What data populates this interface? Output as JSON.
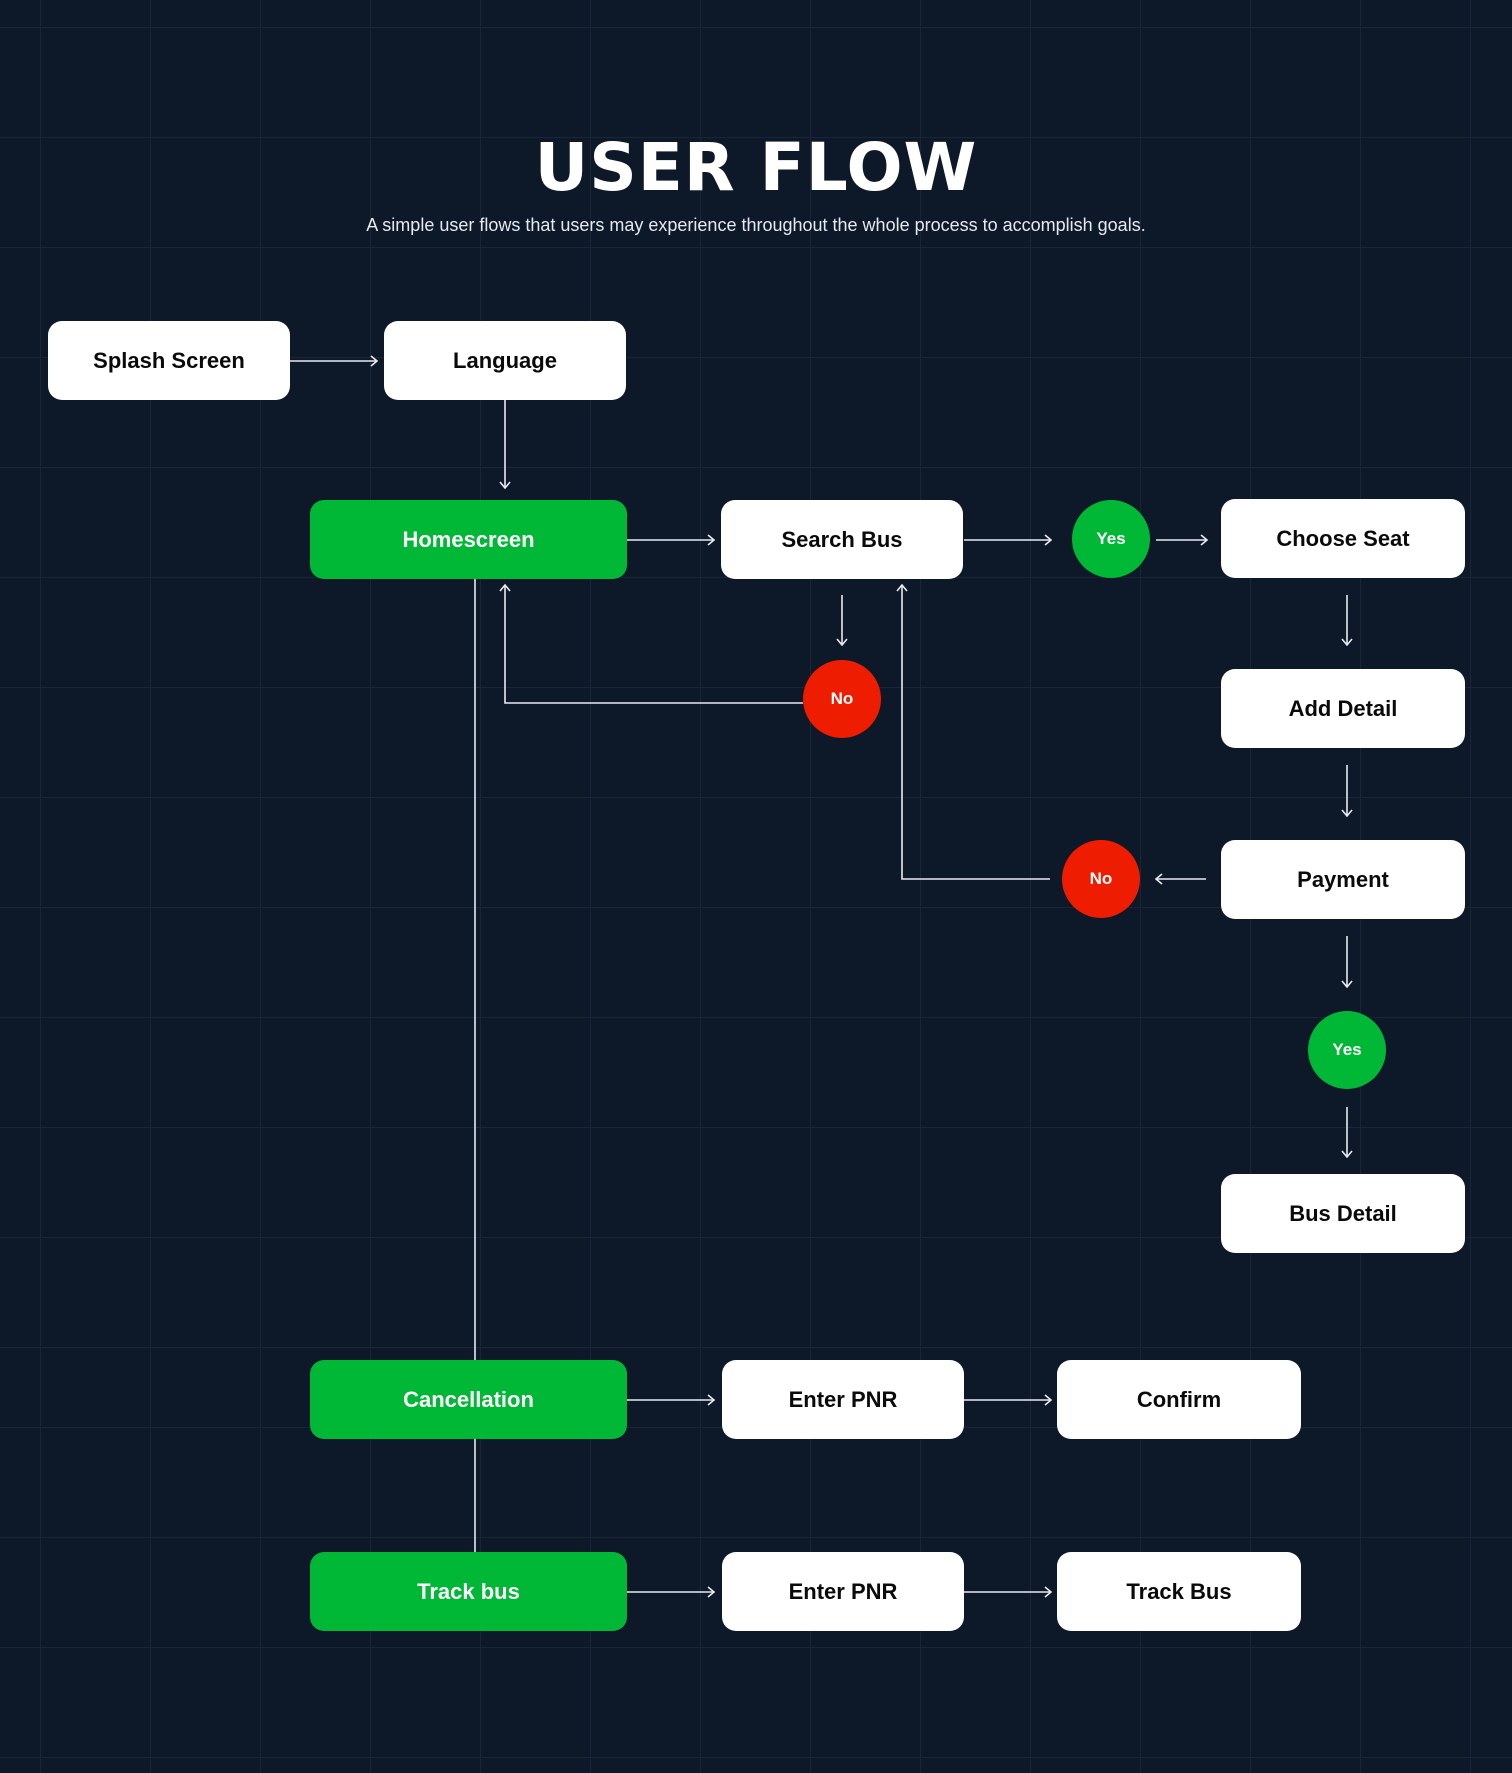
{
  "header": {
    "title": "USER FLOW",
    "subtitle": "A simple user flows that users may experience throughout the whole process to accomplish goals."
  },
  "colors": {
    "background": "#0d1929",
    "grid": "#1a2637",
    "primary_node": "#00b836",
    "screen_node": "#ffffff",
    "yes_decision": "#00b836",
    "no_decision": "#ee1c00",
    "connector": "#e8ebef"
  },
  "nodes": {
    "splash": "Splash Screen",
    "language": "Language",
    "homescreen": "Homescreen",
    "search_bus": "Search Bus",
    "choose_seat": "Choose Seat",
    "add_detail": "Add Detail",
    "payment": "Payment",
    "bus_detail": "Bus Detail",
    "cancellation": "Cancellation",
    "enter_pnr_cancel": "Enter PNR",
    "confirm": "Confirm",
    "track_bus_start": "Track bus",
    "enter_pnr_track": "Enter PNR",
    "track_bus_end": "Track Bus"
  },
  "decisions": {
    "search_yes": "Yes",
    "search_no": "No",
    "payment_no": "No",
    "payment_yes": "Yes"
  },
  "edges": [
    {
      "from": "Splash Screen",
      "to": "Language"
    },
    {
      "from": "Language",
      "to": "Homescreen"
    },
    {
      "from": "Homescreen",
      "to": "Search Bus"
    },
    {
      "from": "Search Bus",
      "to": "Yes"
    },
    {
      "from": "Yes",
      "to": "Choose Seat"
    },
    {
      "from": "Search Bus",
      "to": "No"
    },
    {
      "from": "No",
      "to": "Homescreen"
    },
    {
      "from": "Choose Seat",
      "to": "Add Detail"
    },
    {
      "from": "Add Detail",
      "to": "Payment"
    },
    {
      "from": "Payment",
      "to": "No"
    },
    {
      "from": "No",
      "to": "Search Bus"
    },
    {
      "from": "Payment",
      "to": "Yes"
    },
    {
      "from": "Yes",
      "to": "Bus Detail"
    },
    {
      "from": "Homescreen",
      "to": "Cancellation"
    },
    {
      "from": "Cancellation",
      "to": "Track bus"
    },
    {
      "from": "Cancellation",
      "to": "Enter PNR"
    },
    {
      "from": "Enter PNR",
      "to": "Confirm"
    },
    {
      "from": "Track bus",
      "to": "Enter PNR"
    },
    {
      "from": "Enter PNR",
      "to": "Track Bus"
    }
  ]
}
